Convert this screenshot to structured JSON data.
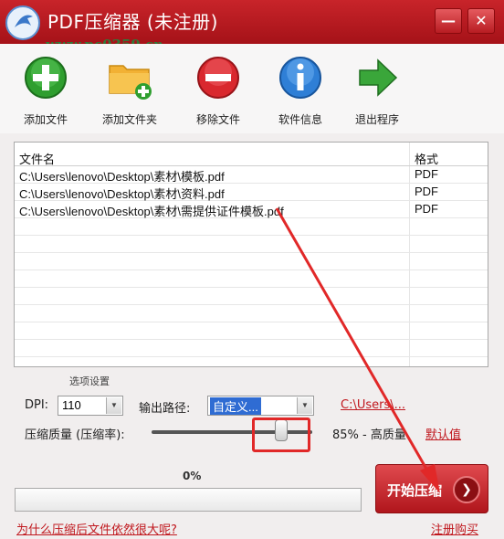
{
  "window": {
    "title": "PDF压缩器 (未注册)",
    "watermark": "www.pc0359.cn",
    "minimize": "—",
    "close": "✕"
  },
  "toolbar": {
    "items": [
      {
        "label": "添加文件",
        "icon": "add-file-icon"
      },
      {
        "label": "添加文件夹",
        "icon": "add-folder-icon"
      },
      {
        "label": "移除文件",
        "icon": "remove-file-icon"
      },
      {
        "label": "软件信息",
        "icon": "info-icon"
      },
      {
        "label": "退出程序",
        "icon": "exit-arrow-icon"
      }
    ]
  },
  "file_list": {
    "headers": [
      "文件名",
      "格式"
    ],
    "rows": [
      {
        "name": "C:\\Users\\lenovo\\Desktop\\素材\\模板.pdf",
        "format": "PDF"
      },
      {
        "name": "C:\\Users\\lenovo\\Desktop\\素材\\资料.pdf",
        "format": "PDF"
      },
      {
        "name": "C:\\Users\\lenovo\\Desktop\\素材\\需提供证件模板.pdf",
        "format": "PDF"
      }
    ]
  },
  "options": {
    "group_title": "选项设置",
    "dpi_label": "DPI:",
    "dpi_value": "110",
    "output_label": "输出路径:",
    "output_value": "自定义...",
    "output_path_link": "C:\\Users\\...",
    "quality_label": "压缩质量 (压缩率):",
    "quality_text": "85% - 高质量",
    "quality_value_percent": 85,
    "default_link": "默认值"
  },
  "progress": {
    "percent_text": "0%",
    "value": 0
  },
  "start_button": {
    "label": "开始压缩",
    "icon": "arrow-circle-icon"
  },
  "footer": {
    "help_link": "为什么压缩后文件依然很大呢?",
    "register_link": "注册购买"
  },
  "colors": {
    "accent": "#c0181e",
    "annotation": "#e12828"
  }
}
